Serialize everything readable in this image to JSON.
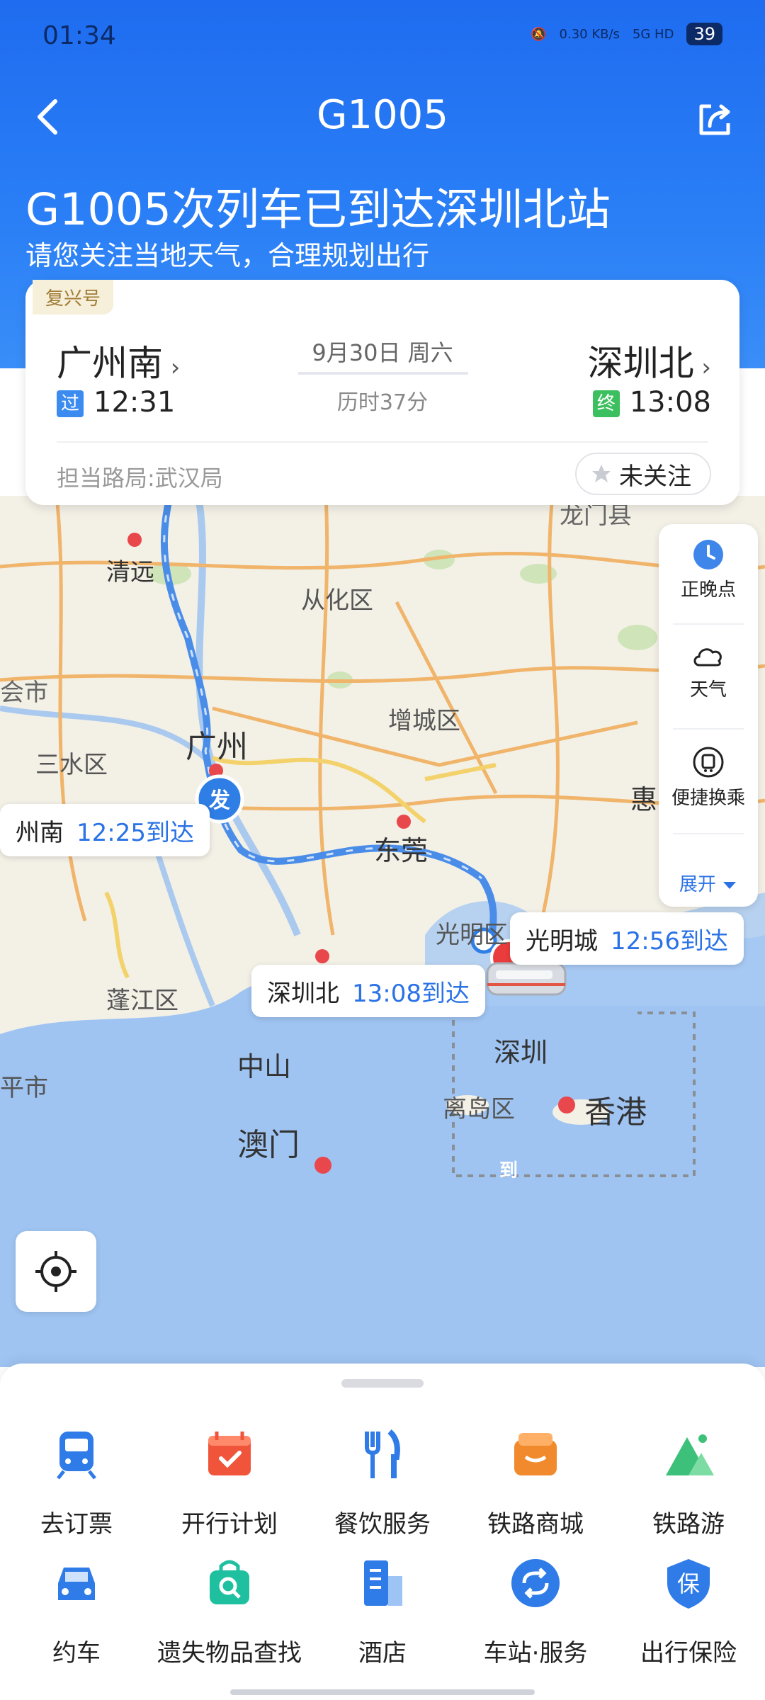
{
  "status_bar": {
    "time": "01:34",
    "net_speed": "0.30\nKB/s",
    "network": "5G HD",
    "battery": "39"
  },
  "nav": {
    "title": "G1005"
  },
  "banner": {
    "headline": "G1005次列车已到达深圳北站",
    "subline": "请您关注当地天气，合理规划出行"
  },
  "trip": {
    "train_type": "复兴号",
    "from_station": "广州南",
    "to_station": "深圳北",
    "date": "9月30日 周六",
    "duration": "历时37分",
    "from_badge": "过",
    "to_badge": "终",
    "from_time": "12:31",
    "to_time": "13:08",
    "bureau": "担当路局:武汉局",
    "follow_label": "未关注"
  },
  "map": {
    "labels": [
      "龙门县",
      "清远",
      "从化区",
      "会市",
      "增城区",
      "广州",
      "三水区",
      "东莞",
      "惠",
      "光明区",
      "蓬江区",
      "中山",
      "深圳",
      "离岛区",
      "香港",
      "澳门",
      "平市"
    ],
    "start_marker": "发",
    "end_marker": "到",
    "bubbles": {
      "guangzhounan": {
        "station": "州南",
        "time": "12:25到达"
      },
      "guangmingcheng": {
        "station": "光明城",
        "time": "12:56到达"
      },
      "shenzhenbei": {
        "station": "深圳北",
        "time": "13:08到达"
      }
    }
  },
  "side_panel": {
    "items": [
      "正晚点",
      "天气",
      "便捷换乘"
    ],
    "expand_label": "展开"
  },
  "services": [
    {
      "label": "去订票",
      "icon": "train-icon",
      "color": "#2f7be8"
    },
    {
      "label": "开行计划",
      "icon": "calendar-icon",
      "color": "#f0553b"
    },
    {
      "label": "餐饮服务",
      "icon": "fork-knife-icon",
      "color": "#2f7be8"
    },
    {
      "label": "铁路商城",
      "icon": "shop-icon",
      "color": "#f08a2c"
    },
    {
      "label": "铁路游",
      "icon": "mountain-icon",
      "color": "#3cc07a"
    },
    {
      "label": "约车",
      "icon": "car-icon",
      "color": "#2f7be8"
    },
    {
      "label": "遗失物品查找",
      "icon": "lost-bag-icon",
      "color": "#1fc0a0"
    },
    {
      "label": "酒店",
      "icon": "hotel-icon",
      "color": "#2f7be8"
    },
    {
      "label": "车站·服务",
      "icon": "station-service-icon",
      "color": "#2f7be8"
    },
    {
      "label": "出行保险",
      "icon": "insurance-icon",
      "color": "#2f7be8"
    }
  ]
}
